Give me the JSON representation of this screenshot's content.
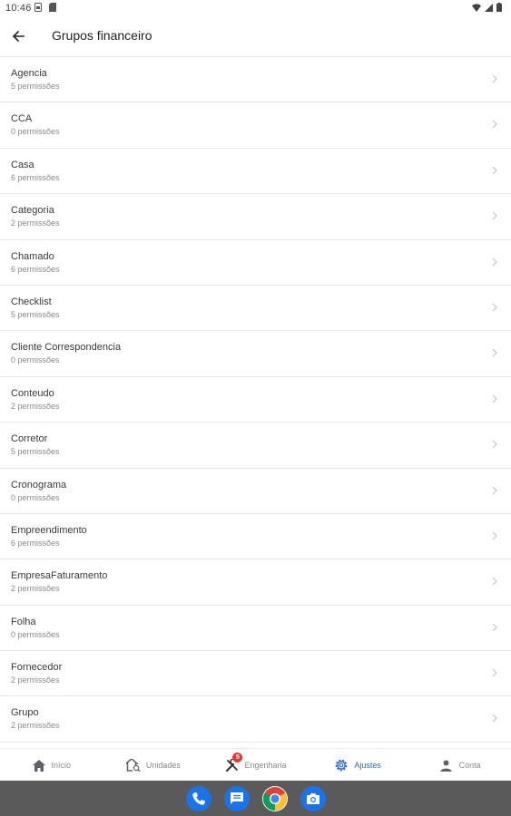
{
  "statusbar": {
    "time": "10:46"
  },
  "appbar": {
    "title": "Grupos financeiro"
  },
  "list": [
    {
      "name": "Agencia",
      "permissions": "5 permissões"
    },
    {
      "name": "CCA",
      "permissions": "0 permissões"
    },
    {
      "name": "Casa",
      "permissions": "6 permissões"
    },
    {
      "name": "Categoria",
      "permissions": "2 permissões"
    },
    {
      "name": "Chamado",
      "permissions": "6 permissões"
    },
    {
      "name": "Checklist",
      "permissions": "5 permissões"
    },
    {
      "name": "Cliente Correspondencia",
      "permissions": "0 permissões"
    },
    {
      "name": "Conteudo",
      "permissions": "2 permissões"
    },
    {
      "name": "Corretor",
      "permissions": "5 permissões"
    },
    {
      "name": "Cronograma",
      "permissions": "0 permissões"
    },
    {
      "name": "Empreendimento",
      "permissions": "6 permissões"
    },
    {
      "name": "EmpresaFaturamento",
      "permissions": "2 permissões"
    },
    {
      "name": "Folha",
      "permissions": "0 permissões"
    },
    {
      "name": "Fornecedor",
      "permissions": "2 permissões"
    },
    {
      "name": "Grupo",
      "permissions": "2 permissões"
    }
  ],
  "bottomnav": {
    "items": [
      {
        "label": "Início",
        "icon": "home-icon"
      },
      {
        "label": "Unidades",
        "icon": "house-search-icon"
      },
      {
        "label": "Engenharia",
        "icon": "tools-icon",
        "badge": "5"
      },
      {
        "label": "Ajustes",
        "icon": "gear-icon",
        "active": true
      },
      {
        "label": "Conta",
        "icon": "person-icon"
      }
    ]
  },
  "dock": {
    "apps": [
      "phone-icon",
      "messages-icon",
      "chrome-icon",
      "camera-icon"
    ]
  },
  "colors": {
    "accent": "#2a6ad6",
    "badge": "#e53935",
    "dock": "#5a5a5a"
  }
}
